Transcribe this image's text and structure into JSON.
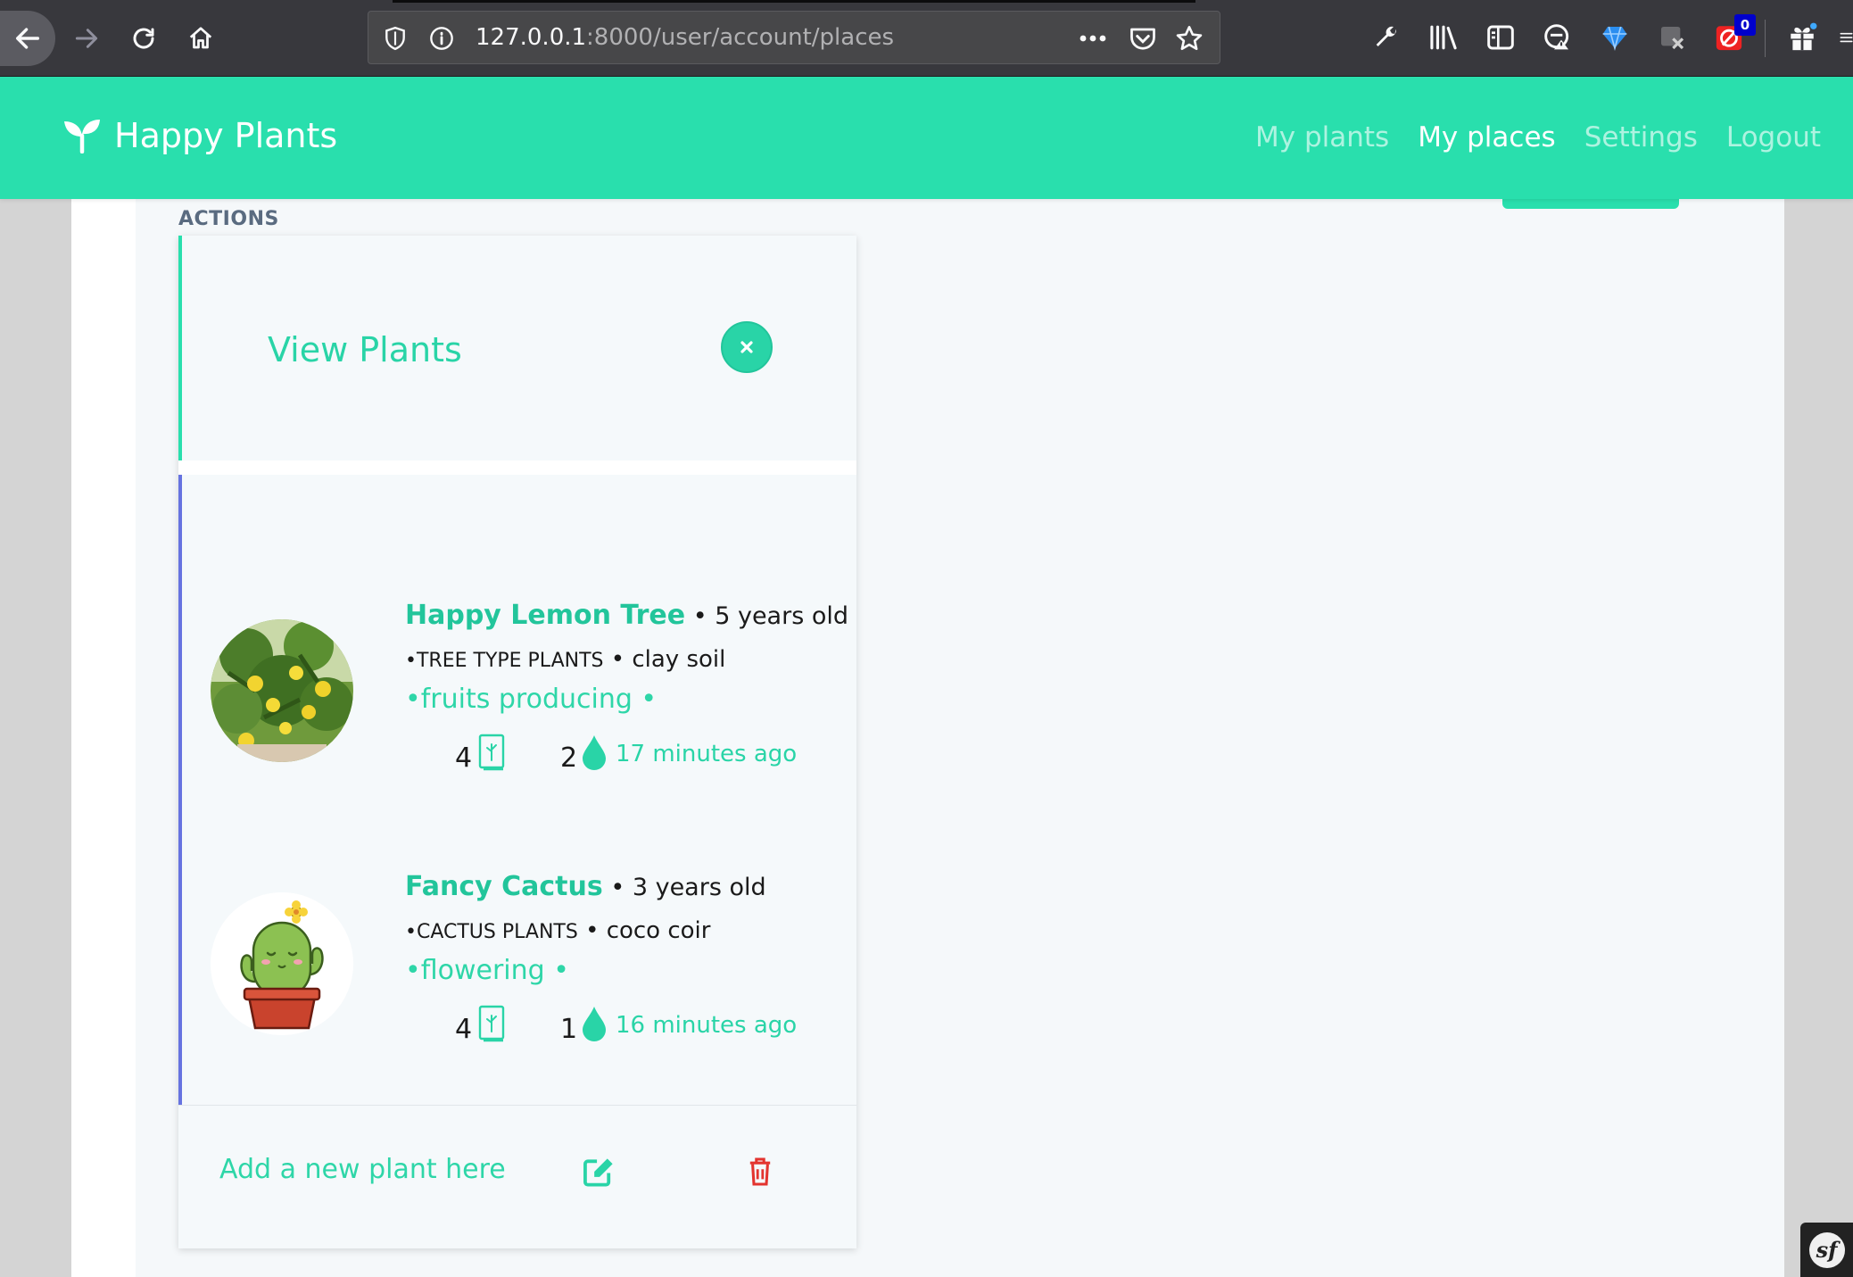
{
  "browser": {
    "url_host": "127.0.0.1",
    "url_rest": ":8000/user/account/places",
    "extension_badge": "0",
    "icons": [
      "back-arrow-icon",
      "forward-arrow-icon",
      "reload-icon",
      "home-icon",
      "shield-icon",
      "info-icon",
      "ellipsis-icon",
      "pocket-icon",
      "star-icon",
      "wrench-icon",
      "library-icon",
      "sidebar-icon",
      "privacy-icon",
      "gem-icon",
      "extension-icon",
      "extension-badge-icon",
      "gift-icon",
      "menu-icon"
    ]
  },
  "header": {
    "brand": "Happy Plants",
    "brand_icon": "sprout-icon",
    "brand_color": "#29dfad",
    "nav": [
      {
        "label": "My plants"
      },
      {
        "label": "My places"
      },
      {
        "label": "Settings"
      },
      {
        "label": "Logout"
      }
    ],
    "active_nav": "My places"
  },
  "sidebar": {
    "actions_label": "ACTIONS"
  },
  "card": {
    "view_plants": "View Plants",
    "close_symbol": "×",
    "plants": [
      {
        "name": "Happy Lemon Tree",
        "age": "5 years old",
        "type": "TREE TYPE PLANTS",
        "soil": "clay soil",
        "tags": "•fruits producing •",
        "count_a": "4",
        "count_b": "2",
        "watered": "17 minutes ago",
        "image": "lemon-tree-photo"
      },
      {
        "name": "Fancy Cactus",
        "age": "3 years old",
        "type": "CACTUS PLANTS",
        "soil": "coco coir",
        "tags": "•flowering •",
        "count_a": "4",
        "count_b": "1",
        "watered": "16 minutes ago",
        "image": "cactus-illustration"
      }
    ],
    "add_plant": "Add a new plant here"
  },
  "colors": {
    "accent": "#29dfad",
    "accent_text": "#29d4a7",
    "plants_border": "#6673e0",
    "danger": "#e3342f"
  }
}
